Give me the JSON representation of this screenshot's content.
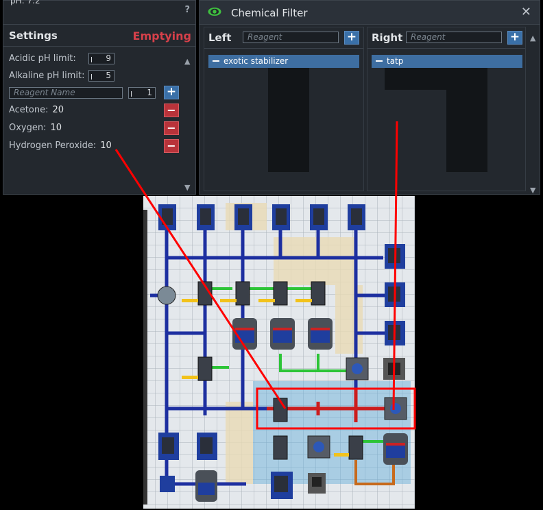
{
  "settings_panel": {
    "ph_cut": "pH: 7.2",
    "help": "?",
    "title": "Settings",
    "status": "Emptying",
    "acidic_label": "Acidic pH limit:",
    "acidic_value": "9",
    "alkaline_label": "Alkaline pH limit:",
    "alkaline_value": "5",
    "reagent_name_placeholder": "Reagent Name",
    "reagent_amount": "1",
    "add": "+",
    "remove": "−",
    "chemicals": [
      {
        "name": "Acetone:",
        "amount": "20"
      },
      {
        "name": "Oxygen:",
        "amount": "10"
      },
      {
        "name": "Hydrogen Peroxide:",
        "amount": "10"
      }
    ]
  },
  "chemical_filter": {
    "title": "Chemical Filter",
    "close": "✕",
    "left": {
      "label": "Left",
      "placeholder": "Reagent",
      "add": "+",
      "items": [
        "exotic stabilizer"
      ]
    },
    "right": {
      "label": "Right",
      "placeholder": "Reagent",
      "add": "+",
      "items": [
        "tatp"
      ]
    }
  },
  "icons": [
    "eye-icon",
    "close-icon",
    "plus-icon",
    "minus-icon",
    "chevron-up-icon",
    "chevron-down-icon",
    "help-icon"
  ],
  "colors": {
    "accent": "#3a70a8",
    "danger": "#b8333a",
    "status": "#d6404a",
    "eye": "#3fbf3f",
    "annotation": "#ff0000"
  }
}
